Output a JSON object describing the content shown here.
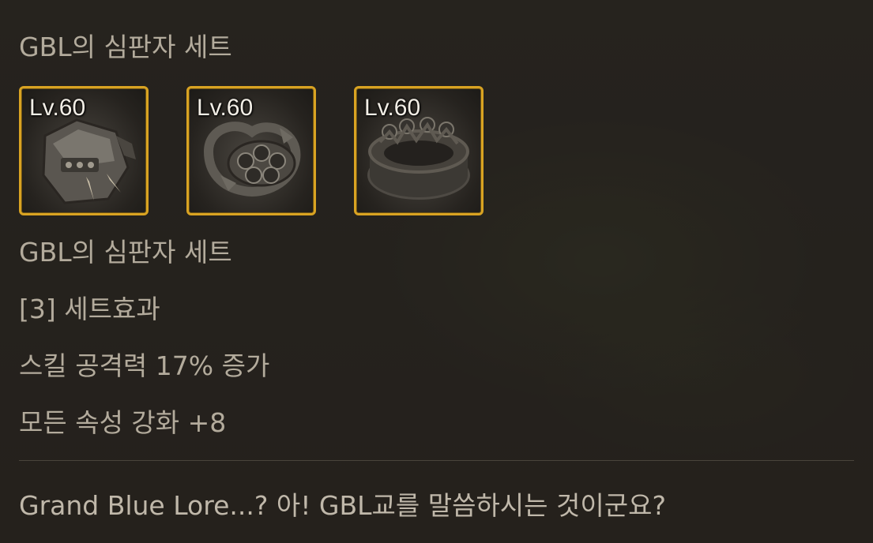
{
  "tooltip": {
    "set_title_top": "GBL의 심판자 세트",
    "items": [
      {
        "level": "Lv.60",
        "icon": "gauntlet-icon"
      },
      {
        "level": "Lv.60",
        "icon": "orb-bracelet-icon"
      },
      {
        "level": "Lv.60",
        "icon": "crown-ring-icon"
      }
    ],
    "set_name": "GBL의 심판자 세트",
    "set_effect_header": "[3] 세트효과",
    "effects": [
      "스킬 공격력 17% 증가",
      "모든 속성 강화 +8"
    ],
    "flavor_text": "Grand Blue Lore...? 아! GBL교를 말씀하시는 것이군요?",
    "colors": {
      "frame": "#d9a322",
      "text": "#b3ab9c",
      "background": "#2a2722"
    }
  }
}
